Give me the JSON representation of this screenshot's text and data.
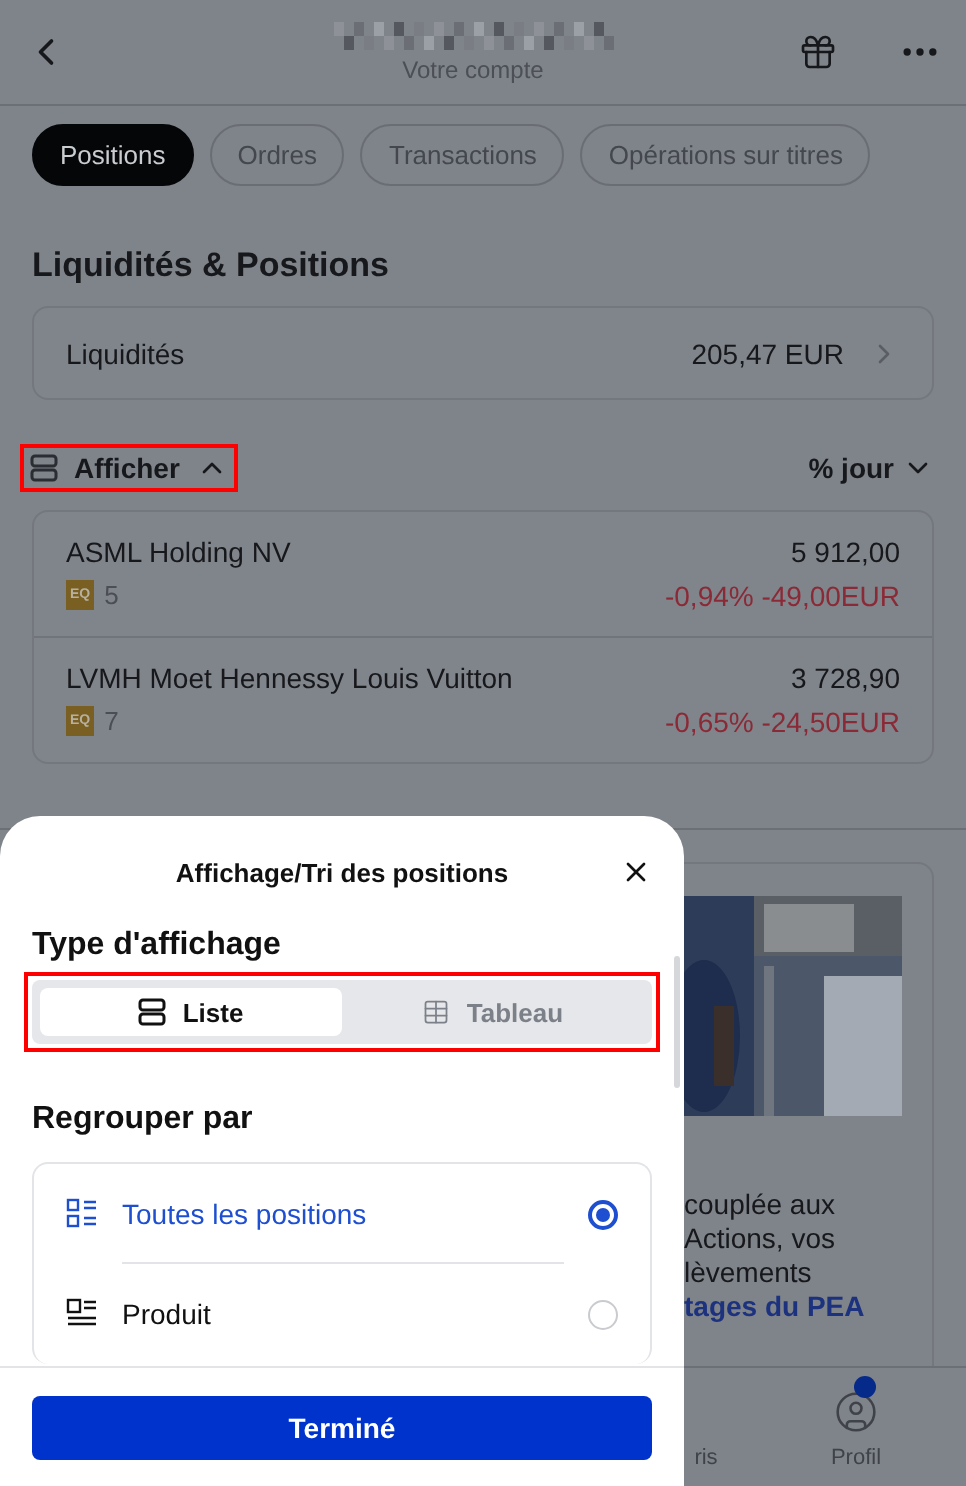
{
  "header": {
    "subtitle": "Votre compte"
  },
  "tabs": [
    {
      "label": "Positions",
      "selected": true
    },
    {
      "label": "Ordres",
      "selected": false
    },
    {
      "label": "Transactions",
      "selected": false
    },
    {
      "label": "Opérations sur titres",
      "selected": false
    }
  ],
  "section_title": "Liquidités & Positions",
  "cash": {
    "label": "Liquidités",
    "value": "205,47 EUR"
  },
  "display_toggle": {
    "label": "Afficher",
    "expanded": true,
    "highlighted": true
  },
  "sort": {
    "label": "% jour"
  },
  "positions": [
    {
      "name": "ASML Holding NV",
      "badge": "EQ",
      "quantity": "5",
      "value": "5 912,00",
      "change_pct": "-0,94%",
      "change_abs": "-49,00EUR"
    },
    {
      "name": "LVMH Moet Hennessy Louis Vuitton",
      "badge": "EQ",
      "quantity": "7",
      "value": "3 728,90",
      "change_pct": "-0,65%",
      "change_abs": "-24,50EUR"
    }
  ],
  "promo": {
    "lines": [
      "couplée aux",
      "Actions, vos",
      "lèvements"
    ],
    "link": "tages du PEA"
  },
  "bottom_nav": [
    {
      "label": "ris"
    },
    {
      "label": "Profil",
      "badge": true
    }
  ],
  "sheet": {
    "title": "Affichage/Tri des positions",
    "view_type": {
      "heading": "Type d'affichage",
      "highlighted": true,
      "options": [
        {
          "label": "Liste",
          "selected": true
        },
        {
          "label": "Tableau",
          "selected": false
        }
      ]
    },
    "group_by": {
      "heading": "Regrouper par",
      "options": [
        {
          "label": "Toutes les positions",
          "selected": true
        },
        {
          "label": "Produit",
          "selected": false
        }
      ]
    },
    "done": "Terminé"
  }
}
